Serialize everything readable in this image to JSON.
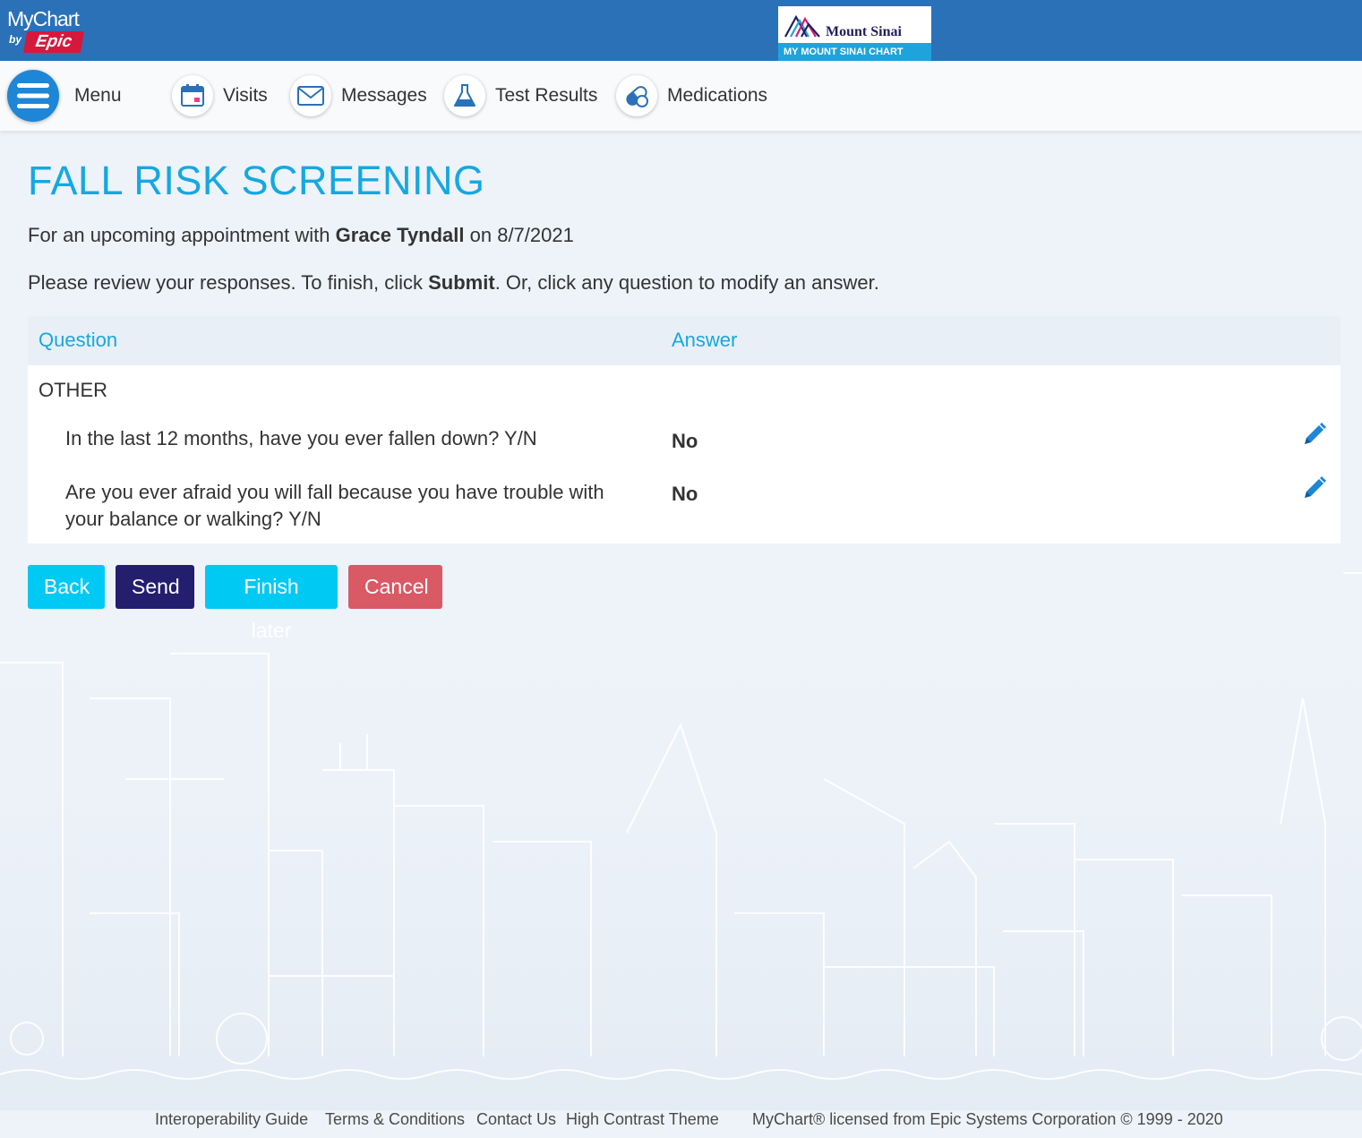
{
  "header": {
    "mychart_logo": "MyChart",
    "mychart_by": "by",
    "epic": "Epic",
    "org_name": "Mount Sinai",
    "org_band": "MY MOUNT SINAI CHART"
  },
  "nav": {
    "menu": "Menu",
    "visits": "Visits",
    "messages": "Messages",
    "test_results": "Test Results",
    "medications": "Medications"
  },
  "page": {
    "title": "FALL RISK SCREENING",
    "appointment_prefix": "For an upcoming appointment with ",
    "provider": "Grace Tyndall",
    "appointment_suffix": " on 8/7/2021",
    "review_prefix": "Please review your responses. To finish, click ",
    "review_bold": "Submit",
    "review_suffix": ". Or, click any question to modify an answer."
  },
  "table": {
    "col_question": "Question",
    "col_answer": "Answer",
    "section": "OTHER",
    "rows": [
      {
        "question": "In the last 12 months, have you ever fallen down? Y/N",
        "answer": "No"
      },
      {
        "question": "Are you ever afraid you will fall because you have trouble with your balance or walking? Y/N",
        "answer": "No"
      }
    ]
  },
  "buttons": {
    "back": "Back",
    "send": "Send",
    "finish_later": "Finish later",
    "cancel": "Cancel"
  },
  "footer": {
    "interop": "Interoperability Guide",
    "terms": "Terms & Conditions",
    "contact": "Contact Us",
    "contrast": "High Contrast Theme",
    "license": "MyChart® licensed from Epic Systems Corporation © 1999 - 2020"
  },
  "colors": {
    "header_blue": "#2a71b8",
    "title_cyan": "#15a8e0",
    "button_cyan": "#00c9f4",
    "button_navy": "#231e6e",
    "button_red": "#d95964"
  }
}
